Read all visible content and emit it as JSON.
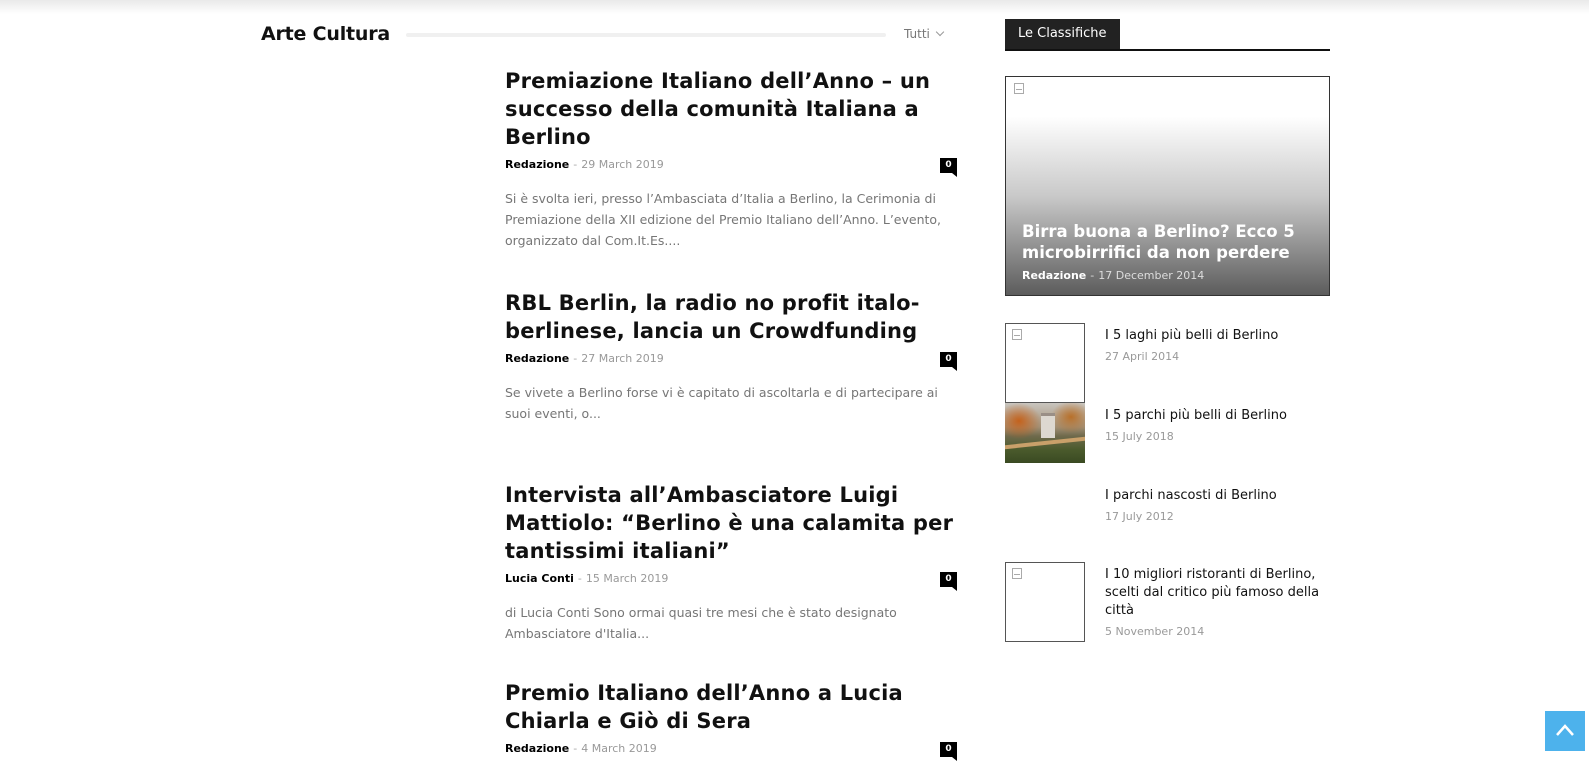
{
  "section": {
    "title": "Arte Cultura",
    "filter_label": "Tutti"
  },
  "posts": [
    {
      "title": "Premiazione Italiano dell’Anno – un successo della comunità Italiana a Berlino",
      "author": "Redazione",
      "date": "29 March 2019",
      "comments": "0",
      "excerpt": "Si è svolta ieri, presso l’Ambasciata d’Italia a Berlino, la Cerimonia di Premiazione della XII edizione del Premio Italiano dell’Anno. L’evento, organizzato dal Com.It.Es...."
    },
    {
      "title": "RBL Berlin, la radio no profit italo-berlinese, lancia un Crowdfunding",
      "author": "Redazione",
      "date": "27 March 2019",
      "comments": "0",
      "excerpt": "Se vivete a Berlino forse vi è capitato di ascoltarla e di partecipare ai suoi eventi, o..."
    },
    {
      "title": "Intervista all’Ambasciatore Luigi Mattiolo: “Berlino è una calamita per tantissimi italiani”",
      "author": "Lucia Conti",
      "date": "15 March 2019",
      "comments": "0",
      "excerpt": "di Lucia Conti Sono ormai quasi tre mesi che è stato designato Ambasciatore d'Italia..."
    },
    {
      "title": "Premio Italiano dell’Anno a Lucia Chiarla e Giò di Sera",
      "author": "Redazione",
      "date": "4 March 2019",
      "comments": "0"
    }
  ],
  "sidebar": {
    "heading": "Le Classifiche",
    "feature": {
      "title": "Birra buona a Berlino? Ecco 5 microbirrifici da non perdere",
      "author": "Redazione",
      "date": "17 December 2014"
    },
    "items": [
      {
        "title": "I 5 laghi più belli di Berlino",
        "date": "27 April 2014"
      },
      {
        "title": "I 5 parchi più belli di Berlino",
        "date": "15 July 2018"
      },
      {
        "title": "I parchi nascosti di Berlino",
        "date": "17 July 2012"
      },
      {
        "title": "I 10 migliori ristoranti di Berlino, scelti dal critico più famoso della città",
        "date": "5 November 2014"
      }
    ]
  },
  "colors": {
    "accent": "#4db2ec",
    "heading_block": "#222222",
    "comment_badge": "#000000"
  },
  "icons": {
    "filter": "chevron-down-icon",
    "back_to_top": "arrow-up-icon",
    "thumbnail_placeholder": "broken-image-icon"
  }
}
